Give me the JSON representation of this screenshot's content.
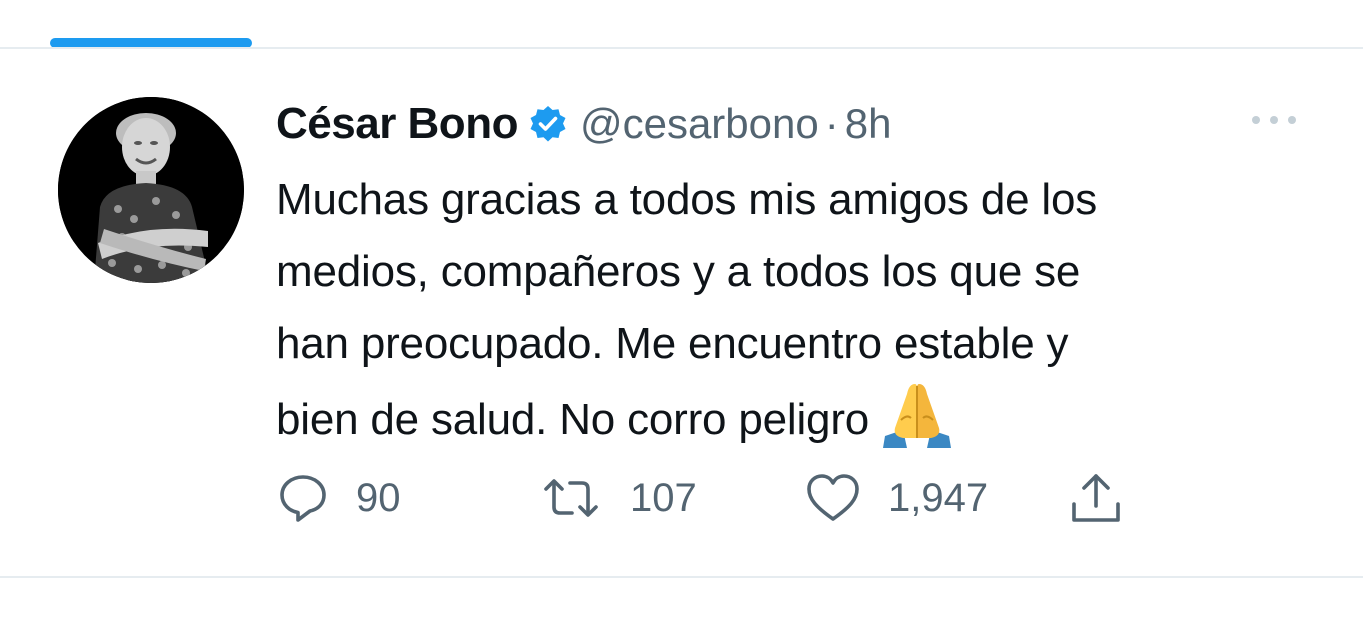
{
  "colors": {
    "accent": "#1d9bf0",
    "text_primary": "#0f1419",
    "text_secondary": "#536471",
    "divider": "#e6ecf0"
  },
  "tweet": {
    "display_name": "César Bono",
    "verified": true,
    "handle": "@cesarbono",
    "separator": "·",
    "timestamp": "8h",
    "text_lines": [
      "Muchas gracias a todos mis amigos de los",
      "medios, compañeros y a todos los que se",
      "han preocupado. Me encuentro estable y",
      "bien de salud. No corro peligro"
    ],
    "emoji": "folded-hands-emoji",
    "actions": {
      "replies": "90",
      "retweets": "107",
      "likes": "1,947"
    }
  },
  "icons": {
    "verified": "verified-badge-icon",
    "more": "more-options-icon",
    "reply": "reply-icon",
    "retweet": "retweet-icon",
    "like": "heart-icon",
    "share": "share-icon"
  }
}
